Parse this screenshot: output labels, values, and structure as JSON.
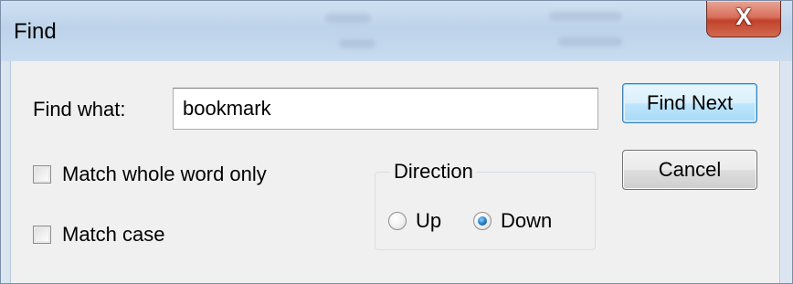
{
  "window": {
    "title": "Find",
    "close_glyph": "X"
  },
  "find": {
    "label": "Find what:",
    "value": "bookmark"
  },
  "buttons": {
    "find_next": "Find Next",
    "cancel": "Cancel"
  },
  "options": {
    "match_whole_word": {
      "label": "Match whole word only",
      "checked": false
    },
    "match_case": {
      "label": "Match case",
      "checked": false
    }
  },
  "direction": {
    "legend": "Direction",
    "up_label": "Up",
    "down_label": "Down",
    "selected": "Down"
  },
  "colors": {
    "accent": "#3c7fb1",
    "close": "#c1422b"
  }
}
